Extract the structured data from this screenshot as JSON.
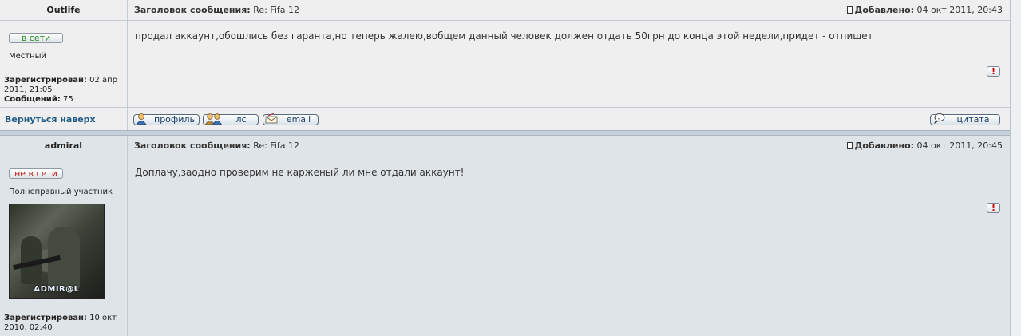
{
  "posts": [
    {
      "author": "Outlife",
      "subject_label": "Заголовок сообщения:",
      "subject": "Re: Fifa 12",
      "added_label": "Добавлено:",
      "added": "04 окт 2011, 20:43",
      "status": "в сети",
      "rank": "Местный",
      "registered_label": "Зарегистрирован:",
      "registered": "02 апр 2011, 21:05",
      "messages_label": "Сообщений:",
      "messages": "75",
      "text": "продал аккаунт,обошлись без гаранта,но теперь жалею,вобщем данный человек должен отдать 50грн до конца этой недели,придет - отпишет",
      "report": "!"
    },
    {
      "author": "admiral",
      "subject_label": "Заголовок сообщения:",
      "subject": "Re: Fifa 12",
      "added_label": "Добавлено:",
      "added": "04 окт 2011, 20:45",
      "status": "не в сети",
      "rank": "Полноправный участник",
      "avatar_text": "ADMIR@L",
      "registered_label": "Зарегистрирован:",
      "registered": "10 окт 2010, 02:40",
      "text": "Доплачу,заодно проверим не карженый ли мне отдали аккаунт!",
      "report": "!"
    }
  ],
  "footer": {
    "back_to_top": "Вернуться наверх",
    "profile": "профиль",
    "pm": "лс",
    "email": "email",
    "quote": "цитата"
  },
  "colors": {
    "online": "#1a8a1a",
    "offline": "#c0201a",
    "link": "#1e5a86"
  }
}
